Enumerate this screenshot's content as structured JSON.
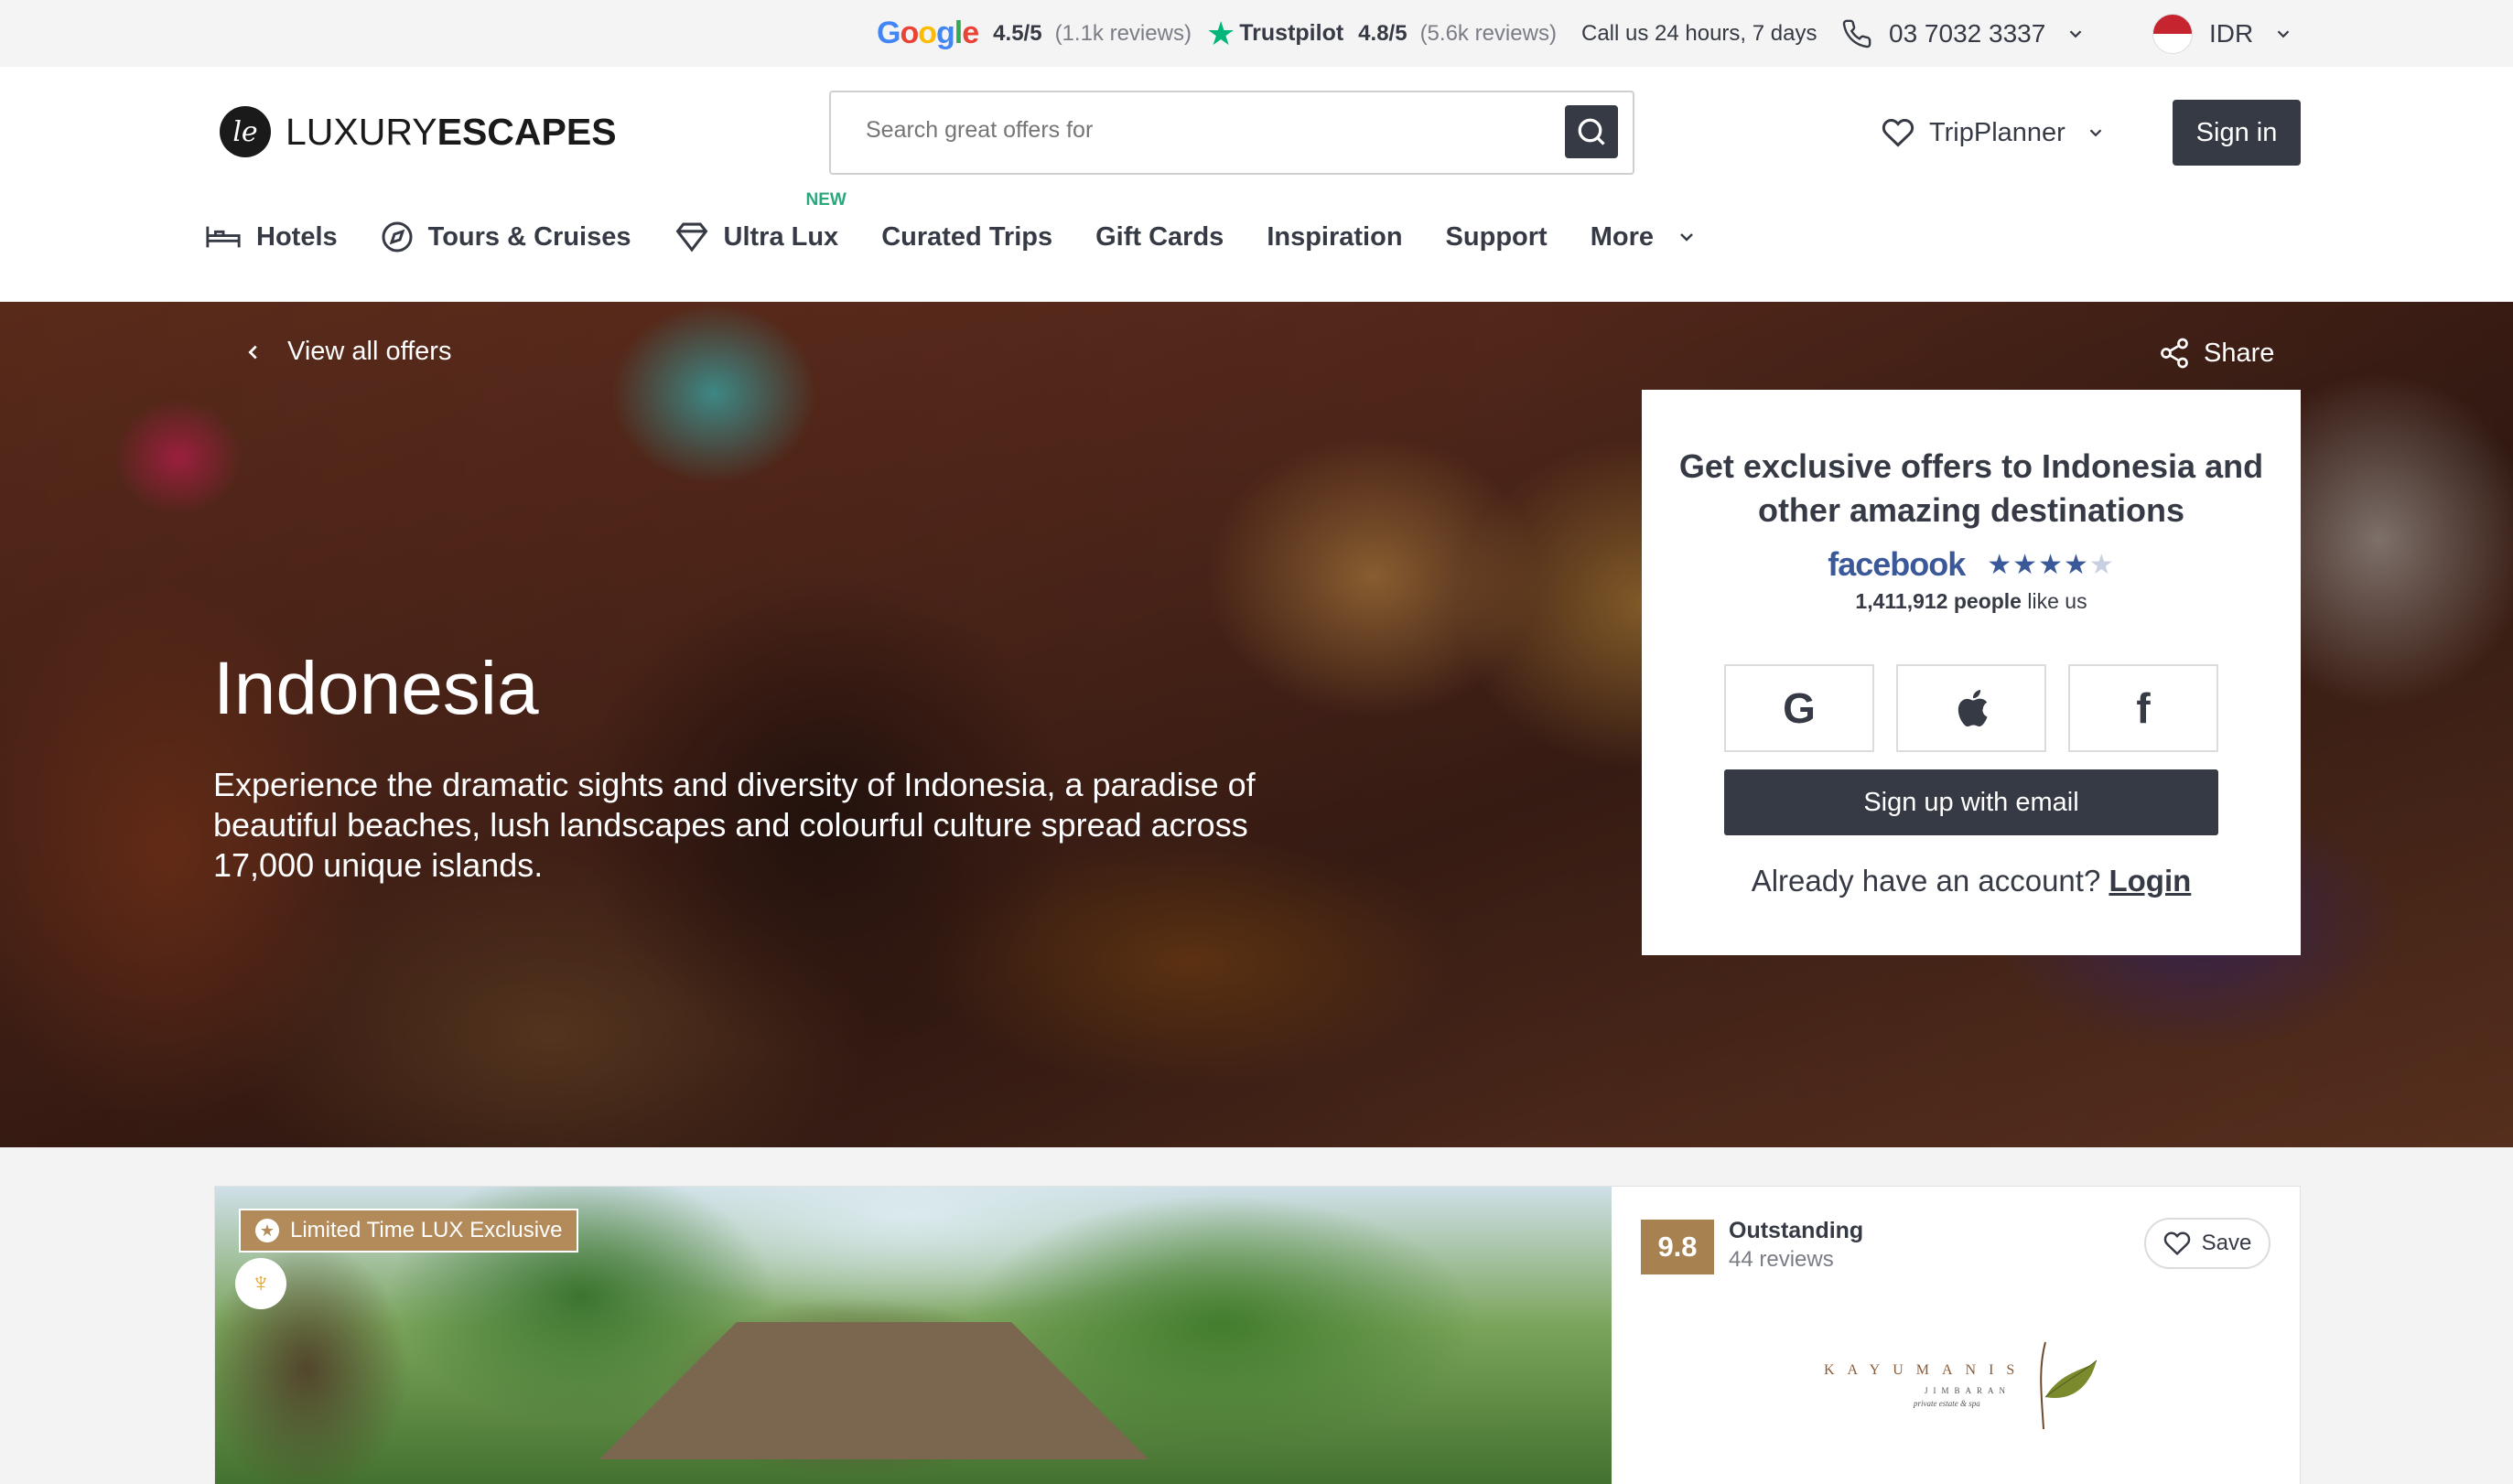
{
  "topbar": {
    "google_rating": "4.5/5",
    "google_reviews": "(1.1k reviews)",
    "trustpilot_name": "Trustpilot",
    "trustpilot_rating": "4.8/5",
    "trustpilot_reviews": "(5.6k reviews)",
    "call_text": "Call us 24 hours, 7 days",
    "phone": "03 7032 3337",
    "currency": "IDR"
  },
  "header": {
    "brand_light": "LUXURY",
    "brand_bold": "ESCAPES",
    "search_placeholder": "Search great offers for",
    "tripplanner_label": "TripPlanner",
    "signin_label": "Sign in"
  },
  "nav": {
    "items": [
      {
        "label": "Hotels",
        "icon": "bed-icon"
      },
      {
        "label": "Tours & Cruises",
        "icon": "compass-icon"
      },
      {
        "label": "Ultra Lux",
        "icon": "diamond-icon",
        "badge": "NEW"
      },
      {
        "label": "Curated Trips"
      },
      {
        "label": "Gift Cards"
      },
      {
        "label": "Inspiration"
      },
      {
        "label": "Support"
      },
      {
        "label": "More",
        "icon": "chevron-down-icon"
      }
    ]
  },
  "hero": {
    "back_label": "View all offers",
    "share_label": "Share",
    "title": "Indonesia",
    "description": "Experience the dramatic sights and diversity of Indonesia, a paradise of beautiful beaches, lush landscapes and colourful culture spread across 17,000 unique islands."
  },
  "signup": {
    "title": "Get exclusive offers to Indonesia and other amazing destinations",
    "facebook_word": "facebook",
    "facebook_stars": 4,
    "likes_count": "1,411,912 people",
    "likes_suffix": " like us",
    "google_label": "G",
    "facebook_label": "f",
    "email_button": "Sign up with email",
    "already_text": "Already have an account? ",
    "login_label": "Login"
  },
  "offer": {
    "badge": "Limited Time LUX Exclusive",
    "score": "9.8",
    "score_word": "Outstanding",
    "reviews": "44 reviews",
    "save_label": "Save",
    "brand_name": "KAYUMANIS",
    "brand_sub": "JIMBARAN",
    "brand_sub2": "private estate & spa"
  },
  "colors": {
    "primary_dark": "#363a45",
    "score_gold": "#a7814f",
    "facebook_blue": "#3b5998",
    "new_green": "#2aa87b",
    "trustpilot_green": "#00b67a"
  }
}
